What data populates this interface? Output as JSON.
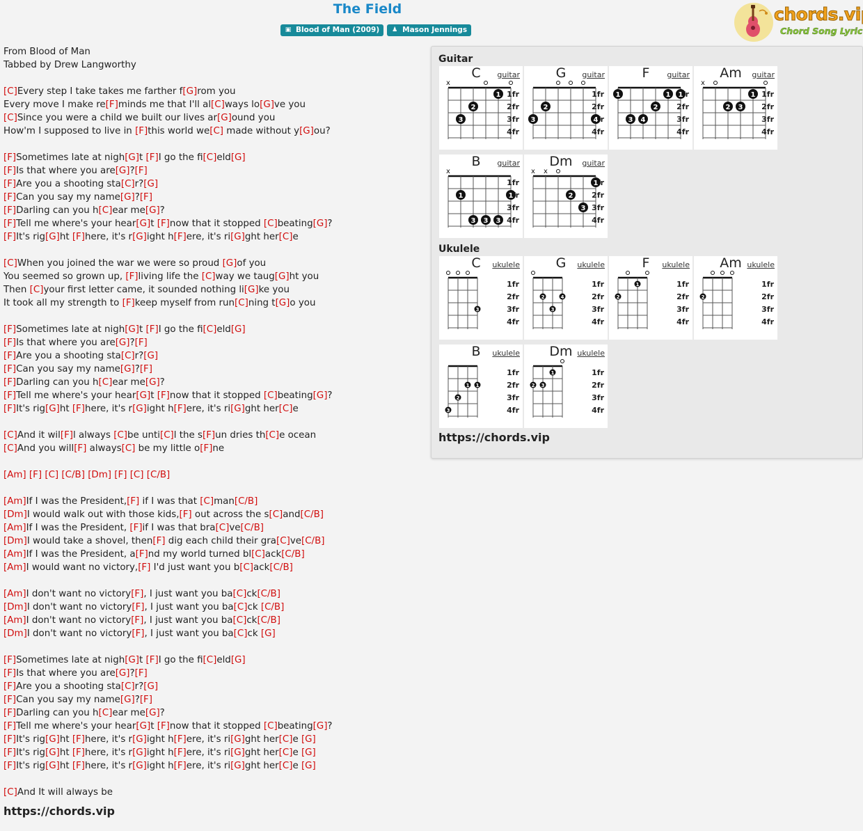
{
  "song": {
    "title": "The Field",
    "album_badge": "Blood of Man (2009)",
    "artist_badge": "Mason Jennings"
  },
  "logo": {
    "brand": "chords.vip",
    "tagline": "Chord Song Lyric"
  },
  "lyrics": [
    "From Blood of Man",
    "Tabbed by Drew Langworthy",
    "",
    "[C]Every step I take takes me farther f[G]rom you",
    "Every move I make re[F]minds me that I'll al[C]ways lo[G]ve you",
    "[C]Since you were a child we built our lives ar[G]ound you",
    "How'm I supposed to live in [F]this world we[C] made without y[G]ou?",
    "",
    "[F]Sometimes late at nigh[G]t [F]I go the fi[C]eld[G]",
    "[F]Is that where you are[G]?[F]",
    "[F]Are you a shooting sta[C]r?[G]",
    "[F]Can you say my name[G]?[F]",
    "[F]Darling can you h[C]ear me[G]?",
    "[F]Tell me where's your hear[G]t [F]now that it stopped [C]beating[G]?",
    "[F]It's rig[G]ht [F]here, it's r[G]ight h[F]ere, it's ri[G]ght her[C]e",
    "",
    "[C]When you joined the war we were so proud [G]of you",
    "You seemed so grown up, [F]living life the [C]way we taug[G]ht you",
    "Then [C]your first letter came, it sounded nothing li[G]ke you",
    "It took all my strength to [F]keep myself from run[C]ning t[G]o you",
    "",
    "[F]Sometimes late at nigh[G]t [F]I go the fi[C]eld[G]",
    "[F]Is that where you are[G]?[F]",
    "[F]Are you a shooting sta[C]r?[G]",
    "[F]Can you say my name[G]?[F]",
    "[F]Darling can you h[C]ear me[G]?",
    "[F]Tell me where's your hear[G]t [F]now that it stopped [C]beating[G]?",
    "[F]It's rig[G]ht [F]here, it's r[G]ight h[F]ere, it's ri[G]ght her[C]e",
    "",
    "[C]And it wil[F]l always [C]be unti[C]l the s[F]un dries th[C]e ocean",
    "[C]And you will[F] always[C] be my little o[F]ne",
    "",
    "[Am] [F] [C] [C/B] [Dm] [F] [C] [C/B]",
    "",
    "[Am]If I was the President,[F] if I was that [C]man[C/B]",
    "[Dm]I would walk out with those kids,[F] out across the s[C]and[C/B]",
    "[Am]If I was the President, [F]if I was that bra[C]ve[C/B]",
    "[Dm]I would take a shovel, then[F] dig each child their gra[C]ve[C/B]",
    "[Am]If I was the President, a[F]nd my world turned bl[C]ack[C/B]",
    "[Am]I would want no victory,[F] I'd just want you b[C]ack[C/B]",
    "",
    "[Am]I don't want no victory[F], I just want you ba[C]ck[C/B]",
    "[Dm]I don't want no victory[F], I just want you ba[C]ck [C/B]",
    "[Am]I don't want no victory[F], I just want you ba[C]ck[C/B]",
    "[Dm]I don't want no victory[F], I just want you ba[C]ck [G]",
    "",
    "[F]Sometimes late at nigh[G]t [F]I go the fi[C]eld[G]",
    "[F]Is that where you are[G]?[F]",
    "[F]Are you a shooting sta[C]r?[G]",
    "[F]Can you say my name[G]?[F]",
    "[F]Darling can you h[C]ear me[G]?",
    "[F]Tell me where's your hear[G]t [F]now that it stopped [C]beating[G]?",
    "[F]It's rig[G]ht [F]here, it's r[G]ight h[F]ere, it's ri[G]ght her[C]e [G]",
    "[F]It's rig[G]ht [F]here, it's r[G]ight h[F]ere, it's ri[G]ght her[C]e [G]",
    "[F]It's rig[G]ht [F]here, it's r[G]ight h[F]ere, it's ri[G]ght her[C]e [G]",
    "",
    "[C]And It will always be"
  ],
  "lyrics_footer_url": "https://chords.vip",
  "panel": {
    "guitar_title": "Guitar",
    "ukulele_title": "Ukulele",
    "footer_url": "https://chords.vip",
    "fret_labels": [
      "1fr",
      "2fr",
      "3fr",
      "4fr"
    ],
    "guitar_link": "guitar",
    "ukulele_link": "ukulele"
  },
  "guitar_chords": [
    {
      "name": "C",
      "frets": [
        "x",
        3,
        2,
        0,
        1,
        0
      ],
      "fingers": [
        null,
        3,
        2,
        null,
        1,
        null
      ]
    },
    {
      "name": "G",
      "frets": [
        3,
        2,
        0,
        0,
        0,
        3
      ],
      "fingers": [
        3,
        2,
        null,
        null,
        null,
        4
      ]
    },
    {
      "name": "F",
      "frets": [
        1,
        3,
        3,
        2,
        1,
        1
      ],
      "fingers": [
        1,
        3,
        4,
        2,
        1,
        1
      ]
    },
    {
      "name": "Am",
      "frets": [
        "x",
        0,
        2,
        2,
        1,
        0
      ],
      "fingers": [
        null,
        null,
        2,
        3,
        1,
        null
      ]
    },
    {
      "name": "B",
      "frets": [
        "x",
        2,
        4,
        4,
        4,
        2
      ],
      "fingers": [
        null,
        1,
        3,
        3,
        3,
        1
      ]
    },
    {
      "name": "Dm",
      "frets": [
        "x",
        "x",
        0,
        2,
        3,
        1
      ],
      "fingers": [
        null,
        null,
        null,
        2,
        3,
        1
      ]
    }
  ],
  "ukulele_chords": [
    {
      "name": "C",
      "frets": [
        0,
        0,
        0,
        3
      ],
      "fingers": [
        null,
        null,
        null,
        3
      ]
    },
    {
      "name": "G",
      "frets": [
        0,
        2,
        3,
        2
      ],
      "fingers": [
        null,
        2,
        3,
        4
      ]
    },
    {
      "name": "F",
      "frets": [
        2,
        0,
        1,
        0
      ],
      "fingers": [
        2,
        null,
        1,
        null
      ]
    },
    {
      "name": "Am",
      "frets": [
        2,
        0,
        0,
        0
      ],
      "fingers": [
        2,
        null,
        null,
        null
      ]
    },
    {
      "name": "B",
      "frets": [
        4,
        3,
        2,
        2
      ],
      "fingers": [
        3,
        2,
        1,
        1
      ]
    },
    {
      "name": "Dm",
      "frets": [
        2,
        2,
        1,
        0
      ],
      "fingers": [
        2,
        3,
        1,
        null
      ]
    }
  ]
}
